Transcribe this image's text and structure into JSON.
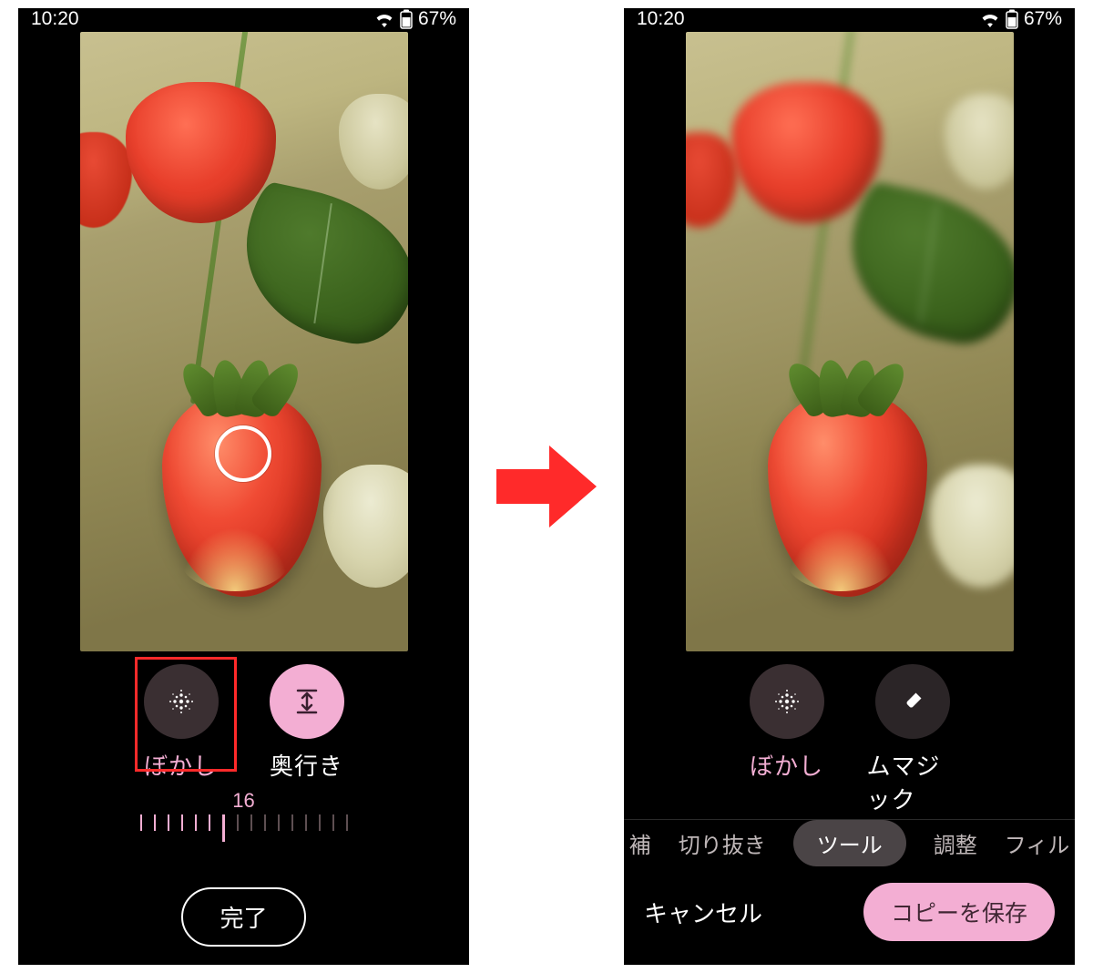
{
  "status": {
    "time": "10:20",
    "battery": "67%"
  },
  "left": {
    "tools": {
      "blur": "ぼかし",
      "depth": "奥行き"
    },
    "slider_value": "16",
    "done": "完了"
  },
  "right": {
    "tools": {
      "blur": "ぼかし",
      "magic": "ムマジック"
    },
    "tabs": {
      "t0": "補",
      "crop": "切り抜き",
      "tools": "ツール",
      "adjust": "調整",
      "filter": "フィル"
    },
    "cancel": "キャンセル",
    "save": "コピーを保存"
  }
}
